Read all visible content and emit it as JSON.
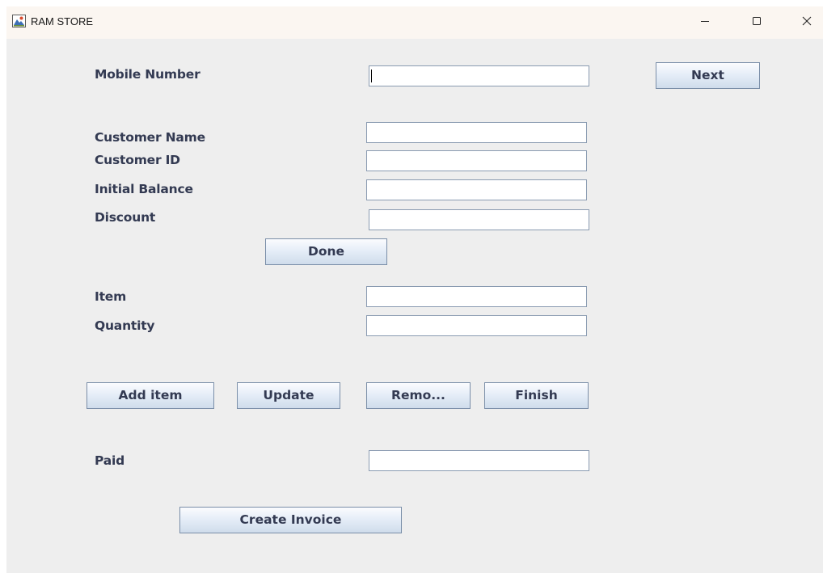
{
  "window": {
    "title": "RAM STORE",
    "controls": {
      "minimize_icon": "minimize-icon",
      "maximize_icon": "maximize-icon",
      "close_icon": "close-icon"
    }
  },
  "form": {
    "mobile_number": {
      "label": "Mobile Number",
      "value": ""
    },
    "next_button": "Next",
    "customer_name": {
      "label": "Customer Name",
      "value": ""
    },
    "customer_id": {
      "label": "Customer ID",
      "value": ""
    },
    "initial_balance": {
      "label": "Initial Balance",
      "value": ""
    },
    "discount": {
      "label": "Discount",
      "value": ""
    },
    "done_button": "Done",
    "item": {
      "label": "Item",
      "value": ""
    },
    "quantity": {
      "label": "Quantity",
      "value": ""
    },
    "add_item_button": "Add item",
    "update_button": "Update",
    "remove_button": "Remo...",
    "finish_button": "Finish",
    "paid": {
      "label": "Paid",
      "value": ""
    },
    "create_invoice_button": "Create Invoice"
  },
  "colors": {
    "title_bar": "#fbf6f1",
    "panel_background": "#eeeeee",
    "label_text": "#333a52",
    "field_border": "#8a9bb1"
  }
}
